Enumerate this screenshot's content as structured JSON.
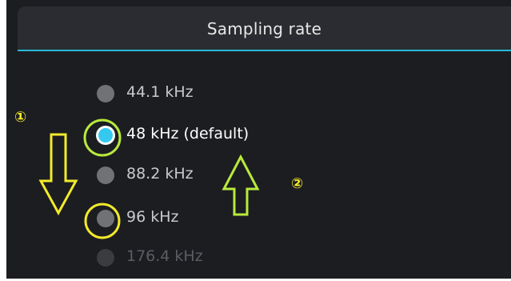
{
  "header": {
    "title": "Sampling rate"
  },
  "options": [
    {
      "label": "44.1 kHz",
      "state": "normal"
    },
    {
      "label": "48 kHz (default)",
      "state": "selected"
    },
    {
      "label": "88.2 kHz",
      "state": "normal"
    },
    {
      "label": "96 kHz",
      "state": "normal"
    },
    {
      "label": "176.4 kHz",
      "state": "faded"
    }
  ],
  "annotations": {
    "marker_1": "①",
    "marker_2": "②"
  },
  "colors": {
    "accent": "#28b8d8",
    "selected_radio": "#35c9ef",
    "annotation_yellow": "#f2ea2a",
    "annotation_green": "#b8ea3c",
    "background": "#1c1d21"
  }
}
